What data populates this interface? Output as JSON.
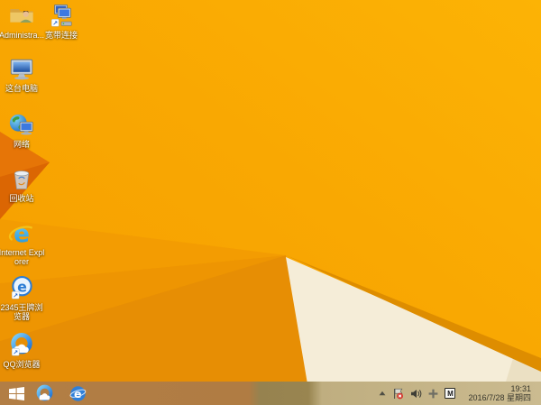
{
  "desktop": {
    "icons": [
      {
        "name": "user-folder",
        "label": "Administra..."
      },
      {
        "name": "broadband-connection",
        "label": "宽带连接"
      },
      {
        "name": "this-pc",
        "label": "这台电脑"
      },
      {
        "name": "network",
        "label": "网络"
      },
      {
        "name": "recycle-bin",
        "label": "回收站"
      },
      {
        "name": "internet-explorer",
        "label": "Internet Explorer"
      },
      {
        "name": "2345-browser",
        "label": "2345王牌浏览器"
      },
      {
        "name": "qq-browser",
        "label": "QQ浏览器"
      }
    ]
  },
  "taskbar": {
    "buttons": [
      "start",
      "qq-browser",
      "internet-explorer"
    ]
  },
  "tray": {
    "icons": [
      "hidden-icons-chevron",
      "action-center-alert",
      "volume",
      "ime-cross",
      "ime-m"
    ],
    "ime_label": "M",
    "time": "19:31",
    "date": "2016/7/28 星期四"
  },
  "colors": {
    "wallpaper_orange": "#F9A602",
    "wallpaper_dark_orange": "#DB6603",
    "wallpaper_cream": "#F5EDD8",
    "wallpaper_amber_edge": "#DE8D00",
    "taskbar_tan": "#B07C43",
    "ie_blue": "#2F7FD8",
    "qq_blue": "#1B6FD4",
    "alert_red": "#D4372C"
  }
}
